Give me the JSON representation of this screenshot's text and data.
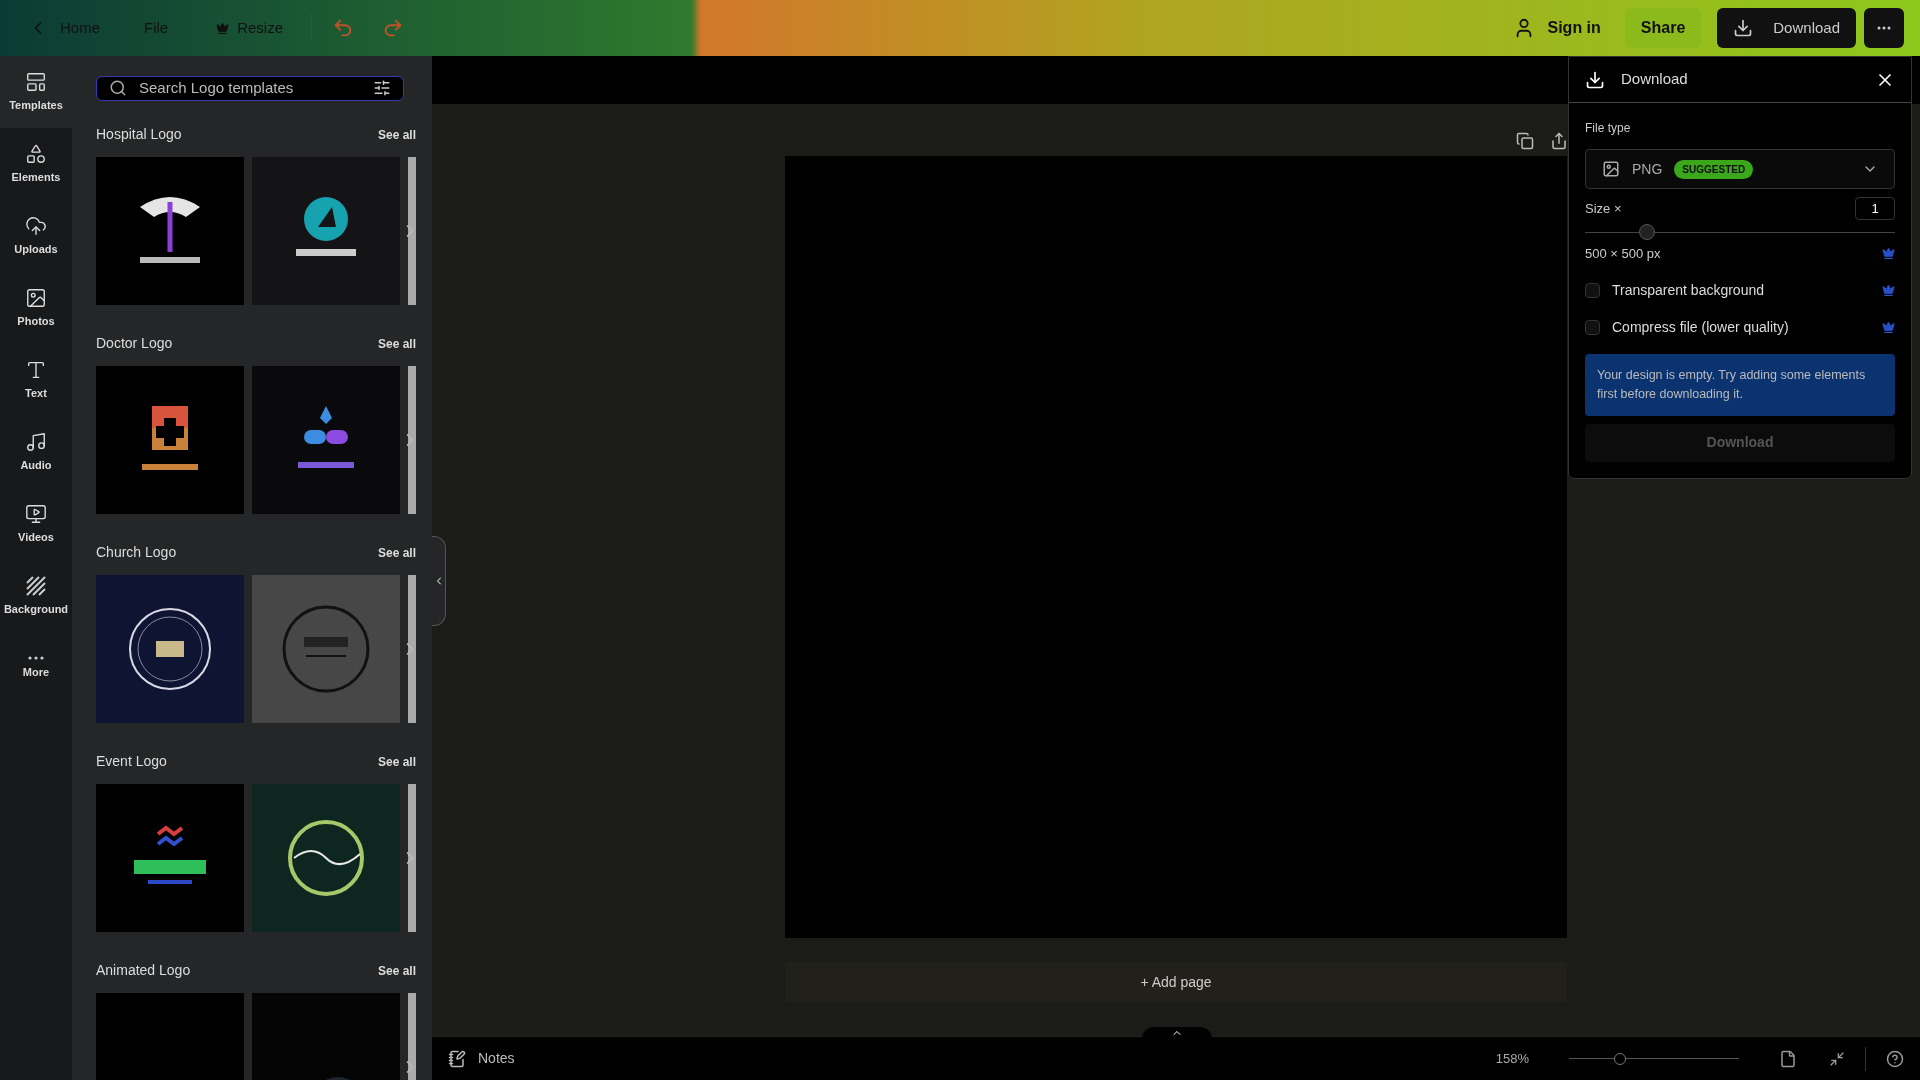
{
  "top_bar": {
    "home": "Home",
    "file": "File",
    "resize": "Resize",
    "sign_in": "Sign in",
    "share": "Share",
    "download": "Download"
  },
  "rail": [
    {
      "label": "Templates",
      "selected": true
    },
    {
      "label": "Elements",
      "selected": false
    },
    {
      "label": "Uploads",
      "selected": false
    },
    {
      "label": "Photos",
      "selected": false
    },
    {
      "label": "Text",
      "selected": false
    },
    {
      "label": "Audio",
      "selected": false
    },
    {
      "label": "Videos",
      "selected": false
    },
    {
      "label": "Background",
      "selected": false
    },
    {
      "label": "More",
      "selected": false
    }
  ],
  "search": {
    "placeholder": "Search Logo templates"
  },
  "sections": [
    {
      "title": "Hospital Logo",
      "see_all": "See all"
    },
    {
      "title": "Doctor Logo",
      "see_all": "See all"
    },
    {
      "title": "Church Logo",
      "see_all": "See all"
    },
    {
      "title": "Event Logo",
      "see_all": "See all"
    },
    {
      "title": "Animated Logo",
      "see_all": "See all"
    }
  ],
  "canvas": {
    "add_page": "+ Add page"
  },
  "download_panel": {
    "title": "Download",
    "file_type_label": "File type",
    "file_type": "PNG",
    "badge": "SUGGESTED",
    "size_label": "Size ×",
    "size_value": "1",
    "size_slider": {
      "level": 0.2
    },
    "dimensions": "500 × 500 px",
    "options": [
      {
        "label": "Transparent background",
        "checked": false
      },
      {
        "label": "Compress file (lower quality)",
        "checked": false
      }
    ],
    "notice": "Your design is empty. Try adding some elements first before downloading it.",
    "button": "Download"
  },
  "bottom_bar": {
    "notes": "Notes",
    "zoom": "158%",
    "zoom_slider": {
      "level": 0.3
    }
  }
}
